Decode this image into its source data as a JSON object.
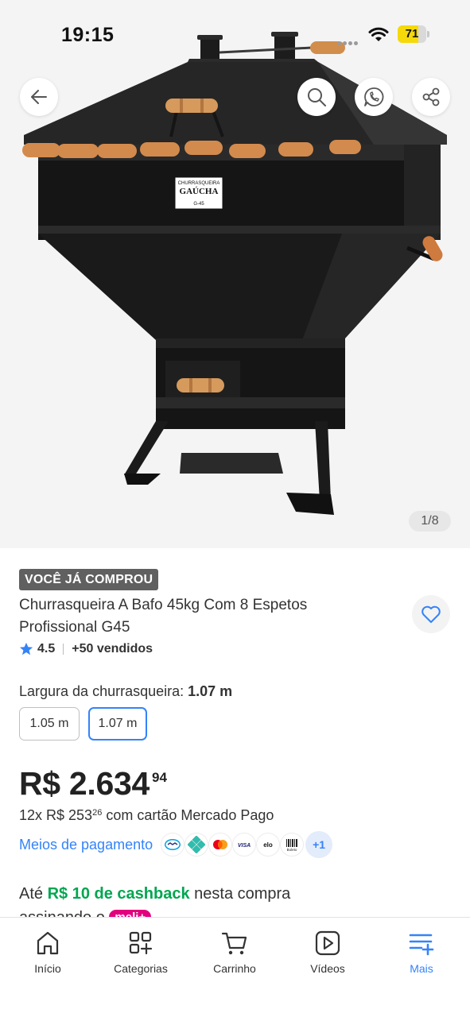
{
  "status_bar": {
    "time": "19:15",
    "battery": "71",
    "battery_level": 0.71
  },
  "gallery": {
    "counter": "1/8",
    "product_plaque": {
      "line1": "CHURRASQUEIRA",
      "line2": "GAÚCHA",
      "line3": "G-45"
    }
  },
  "product": {
    "badge": "VOCÊ JÁ COMPROU",
    "title": "Churrasqueira A Bafo 45kg Com 8 Espetos Profissional G45",
    "rating": "4.5",
    "sold": "+50 vendidos"
  },
  "variation": {
    "label": "Largura da churrasqueira:",
    "selected": "1.07 m",
    "options": [
      "1.05 m",
      "1.07 m"
    ]
  },
  "price": {
    "main": "R$ 2.634",
    "cents": "94",
    "installments_prefix": "12x R$ 253",
    "installments_cents": "26",
    "installments_suffix": " com cartão Mercado Pago"
  },
  "payment": {
    "link": "Meios de pagamento",
    "icons": [
      "mercado-pago-icon",
      "pix-icon",
      "mastercard-icon",
      "visa-icon",
      "elo-icon",
      "boleto-icon"
    ],
    "visa_text": "VISA",
    "elo_text": "elo",
    "boleto_text": "Boleto",
    "more": "+1"
  },
  "cashback": {
    "prefix": "Até ",
    "highlight": "R$ 10 de cashback",
    "middle": " nesta compra",
    "line2": "assinando o ",
    "tag": "meli+"
  },
  "bottom_nav": {
    "items": [
      {
        "label": "Início",
        "icon": "home-icon",
        "active": false
      },
      {
        "label": "Categorias",
        "icon": "categories-icon",
        "active": false
      },
      {
        "label": "Carrinho",
        "icon": "cart-icon",
        "active": false
      },
      {
        "label": "Vídeos",
        "icon": "play-icon",
        "active": false
      },
      {
        "label": "Mais",
        "icon": "menu-plus-icon",
        "active": true
      }
    ]
  },
  "colors": {
    "accent": "#3483fa",
    "green": "#00a650",
    "meli_plus": "#e3007e",
    "badge_bg": "#606060"
  }
}
